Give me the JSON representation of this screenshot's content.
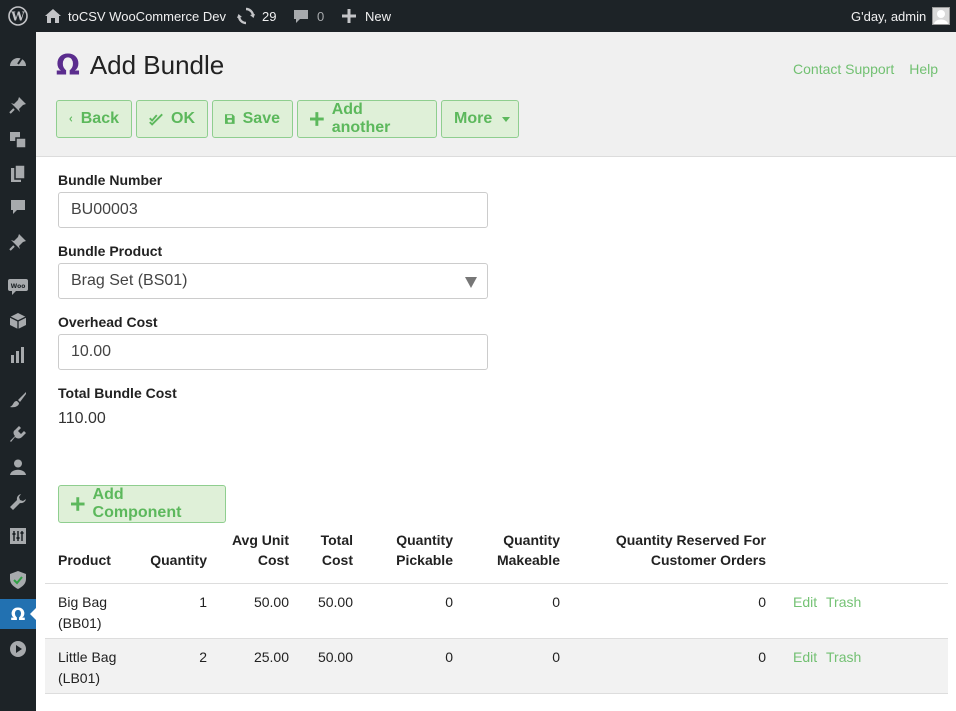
{
  "admin_bar": {
    "site_name": "toCSV WooCommerce Dev",
    "updates_count": "29",
    "comments_count": "0",
    "new_label": "New",
    "greeting": "G'day, admin"
  },
  "page": {
    "title": "Add Bundle",
    "contact_support": "Contact Support",
    "help": "Help"
  },
  "toolbar": {
    "back": "Back",
    "ok": "OK",
    "save": "Save",
    "add_another": "Add another",
    "more": "More"
  },
  "form": {
    "bundle_number_label": "Bundle Number",
    "bundle_number_value": "BU00003",
    "bundle_product_label": "Bundle Product",
    "bundle_product_value": "Brag Set (BS01)",
    "overhead_cost_label": "Overhead Cost",
    "overhead_cost_value": "10.00",
    "total_bundle_cost_label": "Total Bundle Cost",
    "total_bundle_cost_value": "110.00"
  },
  "add_component_label": "Add Component",
  "table": {
    "headers": {
      "product": "Product",
      "quantity": "Quantity",
      "avg_unit_cost_1": "Avg Unit",
      "avg_unit_cost_2": "Cost",
      "total_cost_1": "Total",
      "total_cost_2": "Cost",
      "qty_pickable_1": "Quantity",
      "qty_pickable_2": "Pickable",
      "qty_makeable_1": "Quantity",
      "qty_makeable_2": "Makeable",
      "qty_reserved_1": "Quantity Reserved For",
      "qty_reserved_2": "Customer Orders"
    },
    "rows": [
      {
        "product_name": "Big Bag",
        "product_code": "(BB01)",
        "quantity": "1",
        "avg_unit_cost": "50.00",
        "total_cost": "50.00",
        "pickable": "0",
        "makeable": "0",
        "reserved": "0",
        "edit": "Edit",
        "trash": "Trash"
      },
      {
        "product_name": "Little Bag",
        "product_code": "(LB01)",
        "quantity": "2",
        "avg_unit_cost": "25.00",
        "total_cost": "50.00",
        "pickable": "0",
        "makeable": "0",
        "reserved": "0",
        "edit": "Edit",
        "trash": "Trash"
      }
    ]
  },
  "colors": {
    "admin_bar_bg": "#1d2327",
    "accent_green": "#5cb85c",
    "button_bg": "#dff0d8",
    "active_menu": "#2271b1",
    "omega_purple": "#5b2d8e"
  }
}
